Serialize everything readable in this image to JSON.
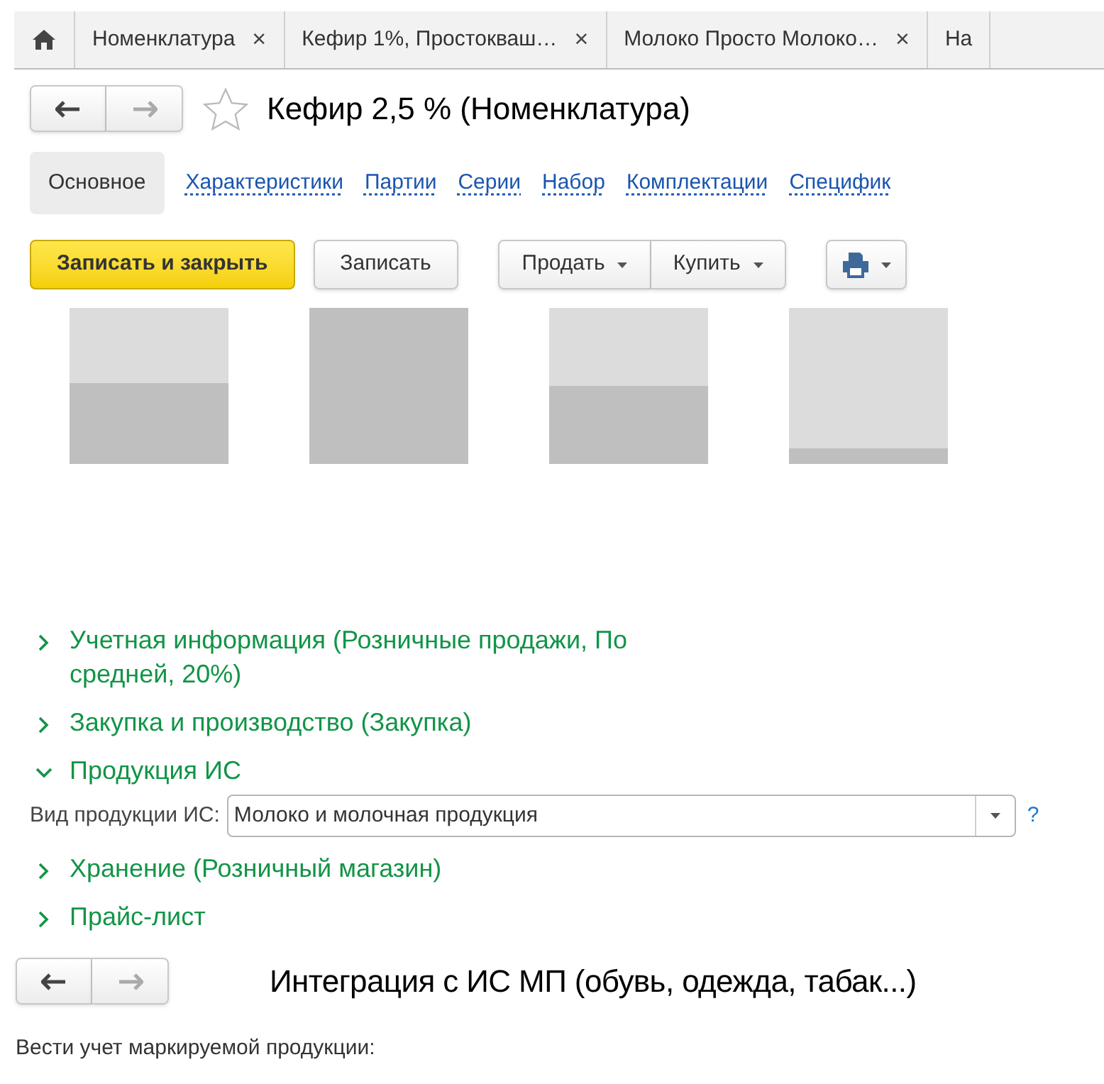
{
  "open_tabs": [
    {
      "label": "Номенклатура",
      "close": "×",
      "selected": false
    },
    {
      "label": "Кефир 1%, Простокваш…",
      "close": "×",
      "selected": false
    },
    {
      "label": "Молоко Просто Молоко…",
      "close": "×",
      "selected": false
    },
    {
      "label": "На",
      "selected": false
    }
  ],
  "title": "Кефир 2,5 % (Номенклатура)",
  "favorite": false,
  "form_tabs": [
    {
      "label": "Основное",
      "selected": true
    },
    {
      "label": "Характеристики",
      "selected": false
    },
    {
      "label": "Партии",
      "selected": false
    },
    {
      "label": "Серии",
      "selected": false
    },
    {
      "label": "Набор",
      "selected": false
    },
    {
      "label": "Комплектации",
      "selected": false
    },
    {
      "label": "Специфик",
      "selected": false
    }
  ],
  "toolbar": {
    "save_close": "Записать и закрыть",
    "save": "Записать",
    "sell": "Продать",
    "buy": "Купить"
  },
  "groups": [
    {
      "title": "Учетная информация (Розничные продажи, По средней, 20%)",
      "expanded": false
    },
    {
      "title": "Закупка и производство (Закупка)",
      "expanded": false
    },
    {
      "title": "Продукция ИС",
      "expanded": true,
      "field": {
        "label": "Вид продукции ИС:",
        "value": "Молоко и молочная продукция",
        "help": "?"
      }
    },
    {
      "title": "Хранение (Розничный магазин)",
      "expanded": false
    },
    {
      "title": "Прайс-лист",
      "expanded": false
    }
  ],
  "integration": {
    "title": "Интеграция с ИС МП (обувь, одежда, табак...)",
    "text": "Вести учет маркируемой продукции:"
  }
}
